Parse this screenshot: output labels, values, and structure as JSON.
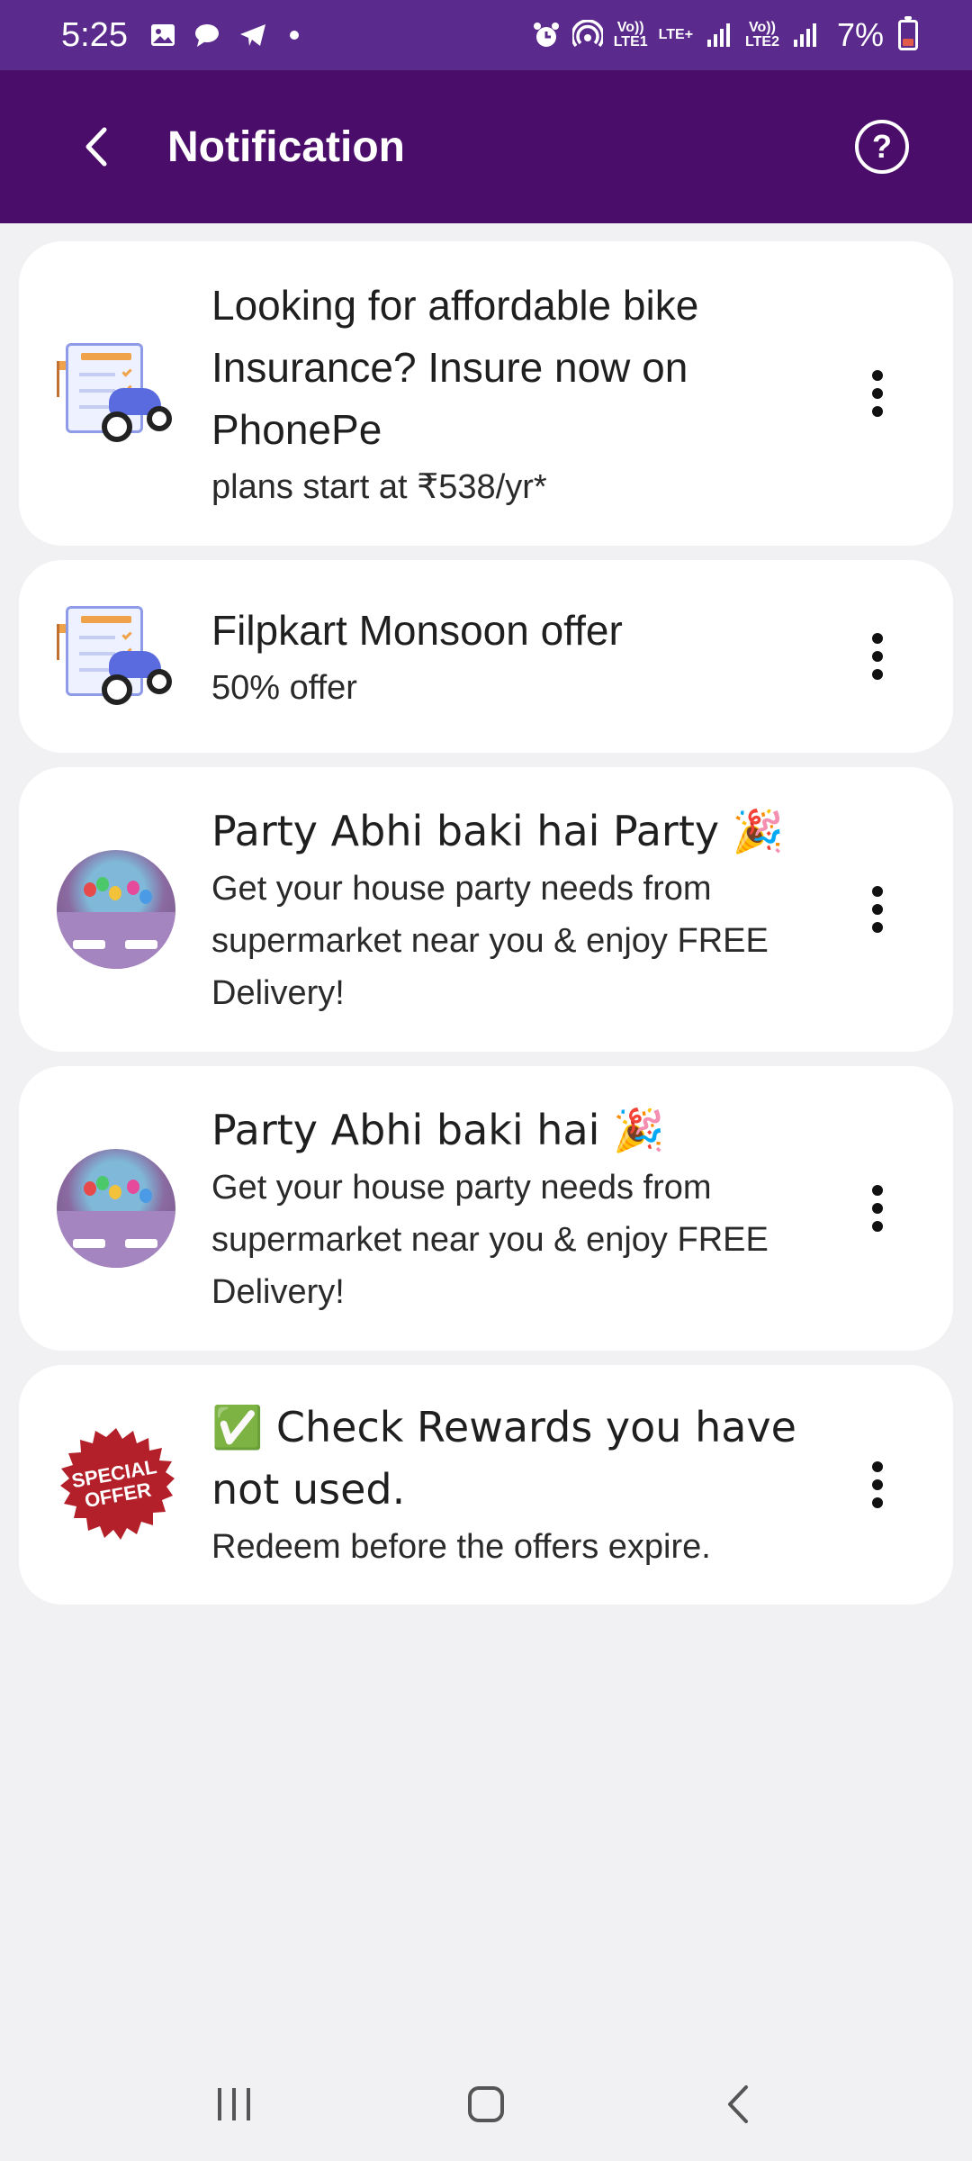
{
  "status_bar": {
    "time": "5:25",
    "network1_top": "Vo))",
    "network1_bottom": "LTE1",
    "network1_extra": "LTE+",
    "network2_top": "Vo))",
    "network2_bottom": "LTE2",
    "battery": "7%"
  },
  "app_bar": {
    "title": "Notification"
  },
  "notifications": [
    {
      "title": "Looking for affordable bike Insurance? Insure now on PhonePe",
      "body": "plans start at ₹538/yr*",
      "image": "bike-insurance"
    },
    {
      "title": "Filpkart Monsoon offer",
      "body": "50% offer",
      "image": "bike-insurance"
    },
    {
      "title": "Party Abhi baki hai Party 🎉",
      "body": "Get your house party needs from supermarket near you & enjoy FREE Delivery!",
      "image": "party-hall"
    },
    {
      "title": "Party Abhi baki hai 🎉",
      "body": "Get your house party needs from supermarket near you & enjoy FREE Delivery!",
      "image": "party-hall"
    },
    {
      "title": "✅ Check Rewards you have not used.",
      "body": "Redeem before the offers expire.",
      "image": "special-offer-seal",
      "seal_text": "SPECIAL OFFER"
    }
  ],
  "colors": {
    "status_bar": "#5a2a8c",
    "app_bar": "#4a0d6a",
    "background": "#f1f1f3",
    "card": "#ffffff",
    "seal": "#b3202a"
  }
}
